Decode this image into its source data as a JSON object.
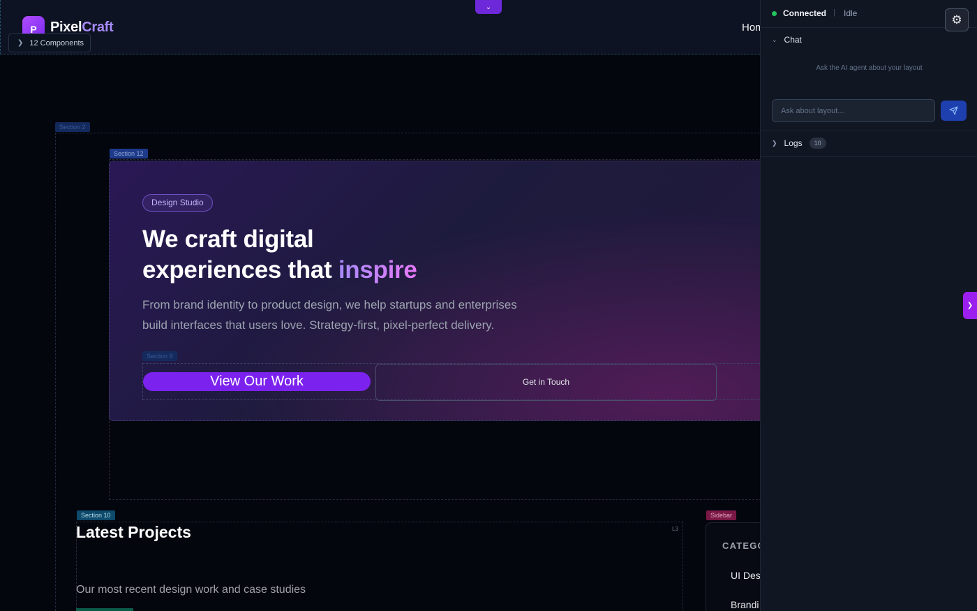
{
  "header": {
    "logo_letter": "P",
    "brand_main": "Pixel",
    "brand_accent": "Craft",
    "nav_home": "Hom",
    "components_toggle": "12 Components"
  },
  "section_tags": {
    "section_2": "Section 2",
    "section_12": "Section 12",
    "section_9": "Section 9",
    "section_10": "Section 10",
    "sidebar": "Sidebar",
    "l3": "L3"
  },
  "hero": {
    "badge": "Design Studio",
    "title_line1": "We craft digital",
    "title_line2": "experiences that ",
    "title_highlight": "inspire",
    "description": "From brand identity to product design, we help startups and enterprises build interfaces that users love. Strategy-first, pixel-perfect delivery.",
    "primary_button": "View Our Work",
    "secondary_button": "Get in Touch"
  },
  "projects": {
    "title": "Latest Projects",
    "subtitle": "Our most recent design work and case studies"
  },
  "sidebar": {
    "title": "CATEGO",
    "items": [
      "UI Des",
      "Brandi"
    ]
  },
  "panel": {
    "status": "Connected",
    "separator": "|",
    "state": "Idle",
    "chat_label": "Chat",
    "chat_hint": "Ask the AI agent about your layout",
    "chat_placeholder": "Ask about layout...",
    "logs_label": "Logs",
    "logs_count": "10"
  },
  "colors": {
    "accent": "#7c22ef",
    "status_green": "#22c55e",
    "send_button": "#1e40af"
  },
  "icons": {
    "settings": "gear-icon",
    "send": "send-icon",
    "collapse_top": "chevron-down-icon",
    "expand_panel": "chevron-right-icon"
  }
}
